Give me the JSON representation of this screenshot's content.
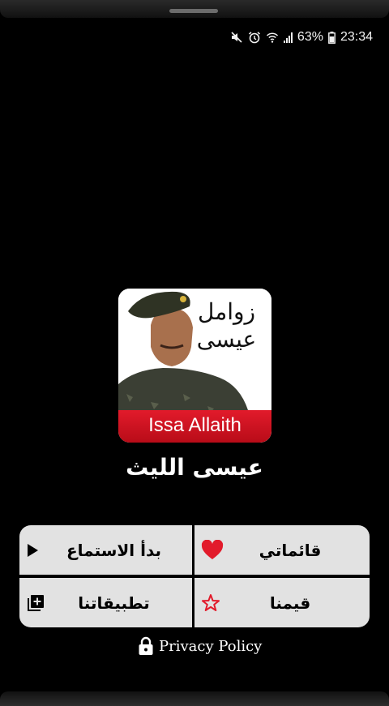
{
  "status_bar": {
    "battery": "63%",
    "time": "23:34"
  },
  "app": {
    "icon_caption": "Issa Allaith",
    "icon_calligraphy_line1": "زوامل",
    "icon_calligraphy_line2": "عيسى",
    "title": "عيسى الليث"
  },
  "menu": {
    "my_lists": "قائماتي",
    "start_listening": "بدأ الاستماع",
    "rate_us": "قيمنا",
    "our_apps": "تطبيقاتنا"
  },
  "footer": {
    "privacy_label": "Privacy Policy"
  },
  "colors": {
    "background": "#000000",
    "button_bg": "#e2e2e2",
    "accent_red": "#e21b2b"
  }
}
